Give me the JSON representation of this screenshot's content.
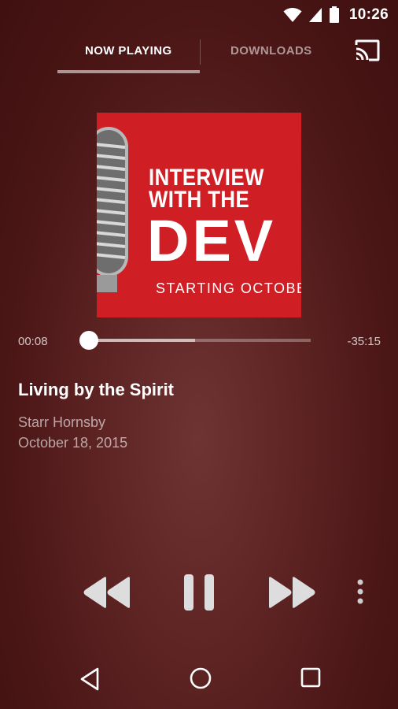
{
  "status_bar": {
    "time": "10:26",
    "icons": [
      "wifi-icon",
      "signal-icon",
      "battery-icon"
    ]
  },
  "tabs": [
    {
      "label": "NOW PLAYING",
      "selected": true
    },
    {
      "label": "DOWNLOADS",
      "selected": false
    }
  ],
  "toolbar": {
    "cast_icon": "cast-icon"
  },
  "album_art": {
    "line1": "INTERVIEW",
    "line2": "WITH THE",
    "line3": "DEV",
    "line4": "STARTING OCTOBER"
  },
  "player": {
    "elapsed": "00:08",
    "remaining": "-35:15",
    "progress_fraction": 0.0,
    "buffered_fraction": 0.48
  },
  "track": {
    "title": "Living by the Spirit",
    "speaker": "Starr Hornsby",
    "date": "October 18, 2015"
  },
  "controls": [
    "rewind-icon",
    "pause-icon",
    "fast-forward-icon",
    "more-vert-icon"
  ],
  "nav": [
    "back-icon",
    "home-icon",
    "recents-icon"
  ],
  "colors": {
    "background": "#5e2424",
    "album_red": "#cf1f25"
  }
}
